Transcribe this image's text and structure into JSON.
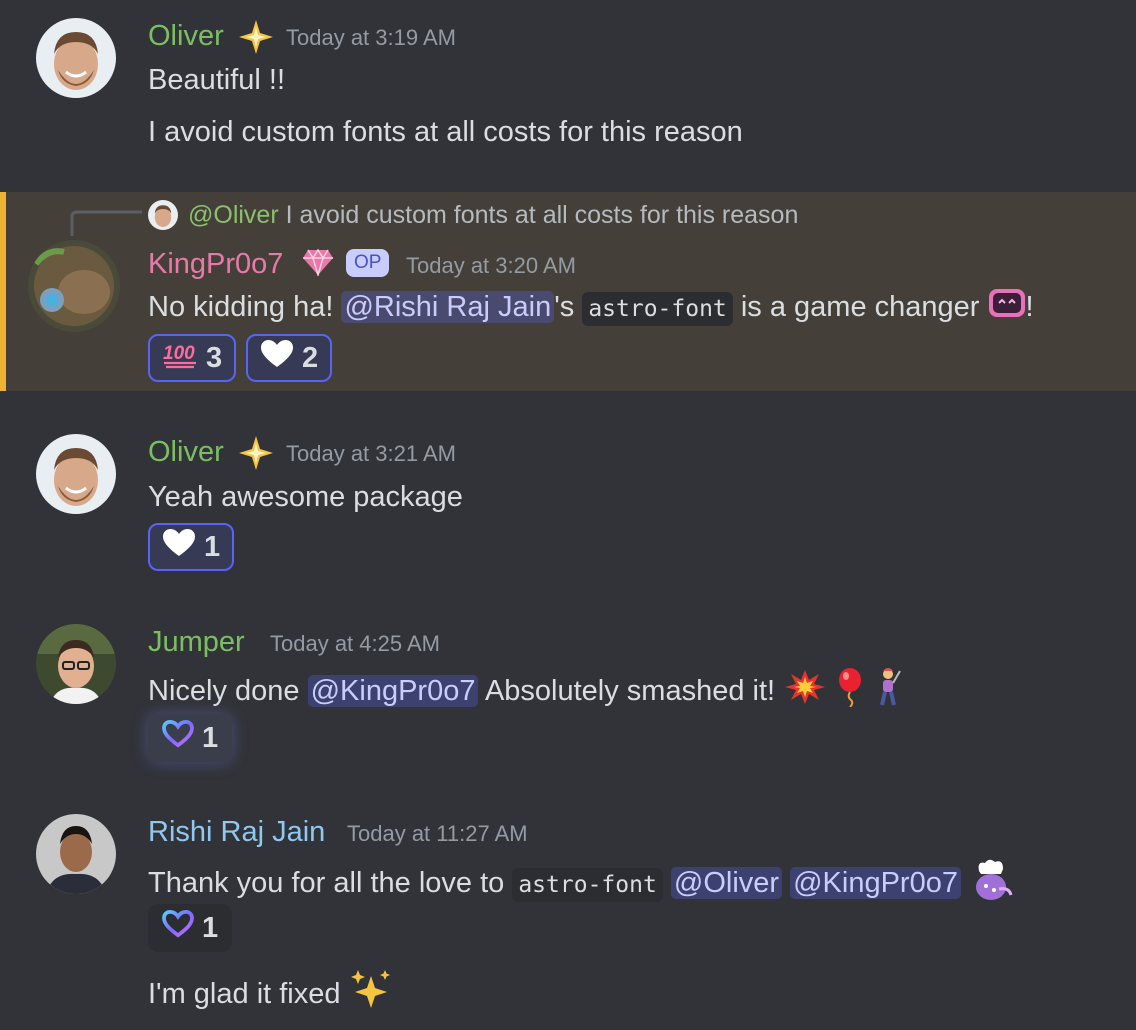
{
  "messages": [
    {
      "author": "Oliver",
      "author_color": "#7cbf63",
      "badge": "sparkle-badge-icon",
      "timestamp": "Today at 3:19 AM",
      "lines": [
        "Beautiful !!",
        "I avoid custom fonts at all costs for this reason"
      ]
    },
    {
      "author": "KingPr0o7",
      "author_color": "#e879a8",
      "badge": "gem-icon",
      "op_tag": "OP",
      "timestamp": "Today at 3:20 AM",
      "reply": {
        "mention": "@Oliver",
        "text": "I avoid custom fonts at all costs for this reason"
      },
      "text": {
        "part1": "No kidding ha!",
        "mention": "@Rishi Raj Jain",
        "part2": "'s",
        "code": "astro-font",
        "part3": "is a game changer",
        "part4": "!"
      },
      "reactions": [
        {
          "emoji": "hundred-points-icon",
          "count": "3"
        },
        {
          "emoji": "white-heart-icon",
          "count": "2"
        }
      ]
    },
    {
      "author": "Oliver",
      "author_color": "#7cbf63",
      "badge": "sparkle-badge-icon",
      "timestamp": "Today at 3:21 AM",
      "text": "Yeah awesome package",
      "reactions": [
        {
          "emoji": "white-heart-icon",
          "count": "1"
        }
      ]
    },
    {
      "author": "Jumper",
      "author_color": "#7cbf63",
      "timestamp": "Today at 4:25 AM",
      "text": {
        "part1": "Nicely done",
        "mention": "@KingPr0o7",
        "part2": "Absolutely smashed it!"
      },
      "reactions": [
        {
          "emoji": "gradient-heart-icon",
          "count": "1"
        }
      ]
    },
    {
      "author": "Rishi Raj Jain",
      "author_color": "#8fc8f0",
      "timestamp": "Today at 11:27 AM",
      "text": {
        "part1": "Thank you for all the love to",
        "code": "astro-font",
        "mention1": "@Oliver",
        "mention2": "@KingPr0o7"
      },
      "reactions": [
        {
          "emoji": "gradient-heart-icon",
          "count": "1"
        }
      ],
      "followup": "I'm glad it fixed"
    }
  ],
  "colors": {
    "background": "#313338",
    "highlight": "#444039",
    "highlight_bar": "#f0b232",
    "mention_bg": "#5865f2",
    "text": "#dbdee1",
    "muted": "#949ba4"
  }
}
